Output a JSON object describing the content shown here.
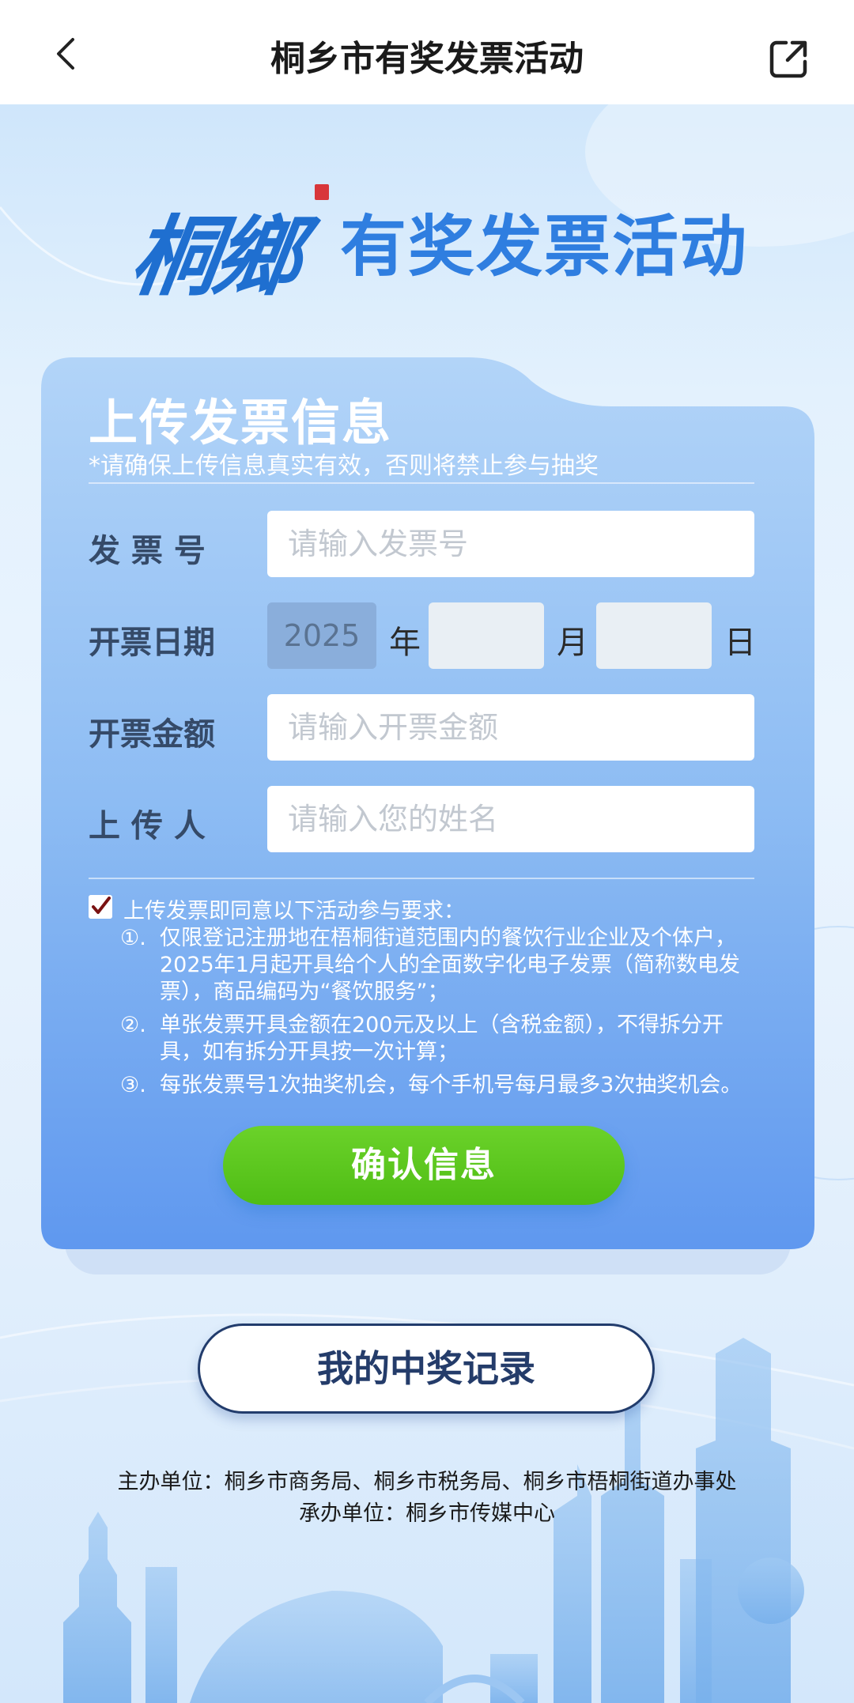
{
  "nav": {
    "title": "桐乡市有奖发票活动"
  },
  "banner": {
    "brush_text": "桐鄉",
    "main_text": "有奖发票活动"
  },
  "form": {
    "heading": "上传发票信息",
    "notice": "*请确保上传信息真实有效，否则将禁止参与抽奖",
    "invoice_no": {
      "label": "发 票 号",
      "placeholder": "请输入发票号",
      "value": ""
    },
    "date": {
      "label": "开票日期",
      "year": "2025",
      "year_unit": "年",
      "month": "",
      "month_unit": "月",
      "day": "",
      "day_unit": "日"
    },
    "amount": {
      "label": "开票金额",
      "placeholder": "请输入开票金额",
      "value": ""
    },
    "uploader": {
      "label": "上 传 人",
      "placeholder": "请输入您的姓名",
      "value": ""
    },
    "agreement": {
      "checked": true,
      "intro": "上传发票即同意以下活动参与要求：",
      "rules": [
        {
          "num": "①.",
          "text": "仅限登记注册地在梧桐街道范围内的餐饮行业企业及个体户，2025年1月起开具给个人的全面数字化电子发票（简称数电发票），商品编码为“餐饮服务”；"
        },
        {
          "num": "②.",
          "text": "单张发票开具金额在200元及以上（含税金额），不得拆分开具，如有拆分开具按一次计算；"
        },
        {
          "num": "③.",
          "text": "每张发票号1次抽奖机会，每个手机号每月最多3次抽奖机会。"
        }
      ]
    },
    "confirm_label": "确认信息"
  },
  "records_label": "我的中奖记录",
  "footer": {
    "host": "主办单位：桐乡市商务局、桐乡市税务局、桐乡市梧桐街道办事处",
    "organizer": "承办单位：桐乡市传媒中心"
  },
  "colors": {
    "primary": "#2f7ee0",
    "confirm": "#52c41a",
    "card_top": "#a8cdf7",
    "card_bottom": "#5f98ef"
  }
}
